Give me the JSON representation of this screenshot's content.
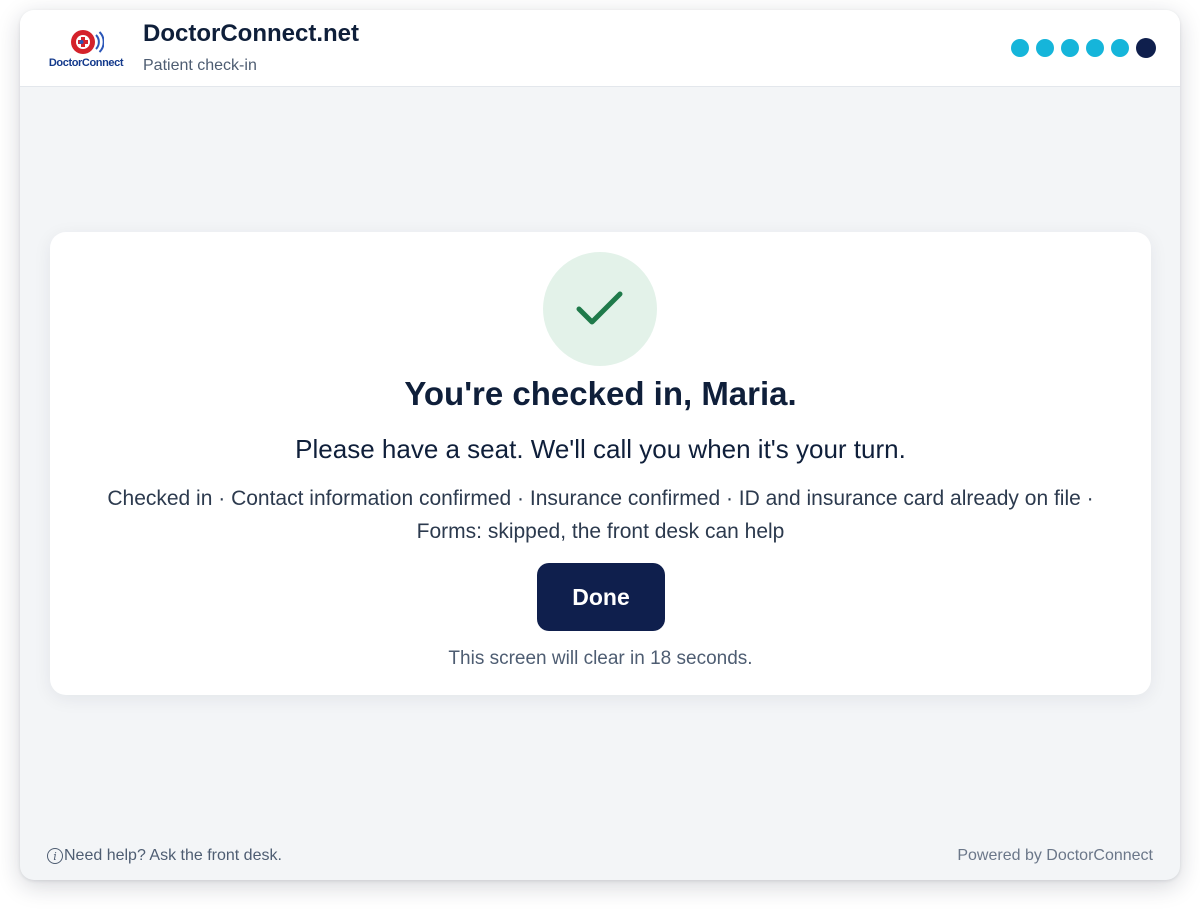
{
  "header": {
    "logo_text": "DoctorConnect",
    "title": "DoctorConnect.net",
    "subtitle": "Patient check-in",
    "steps": {
      "total": 6,
      "current": 6
    }
  },
  "confirmation": {
    "icon": "checkmark-icon",
    "headline": "You're checked in, Maria.",
    "subline": "Please have a seat. We'll call you when it's your turn.",
    "summary": "Checked in · Contact information confirmed · Insurance confirmed · ID and insurance card already on file · Forms: skipped, the front desk can help",
    "done_label": "Done",
    "countdown": "This screen will clear in 18 seconds."
  },
  "footer": {
    "help_text": "Need help? Ask the front desk.",
    "powered_by": "Powered by DoctorConnect"
  },
  "colors": {
    "accent_navy": "#0f1f4d",
    "step_cyan": "#15b5da",
    "success_green": "#1f7a4a",
    "success_bg": "#e3f2e9",
    "page_bg": "#f3f5f7"
  }
}
